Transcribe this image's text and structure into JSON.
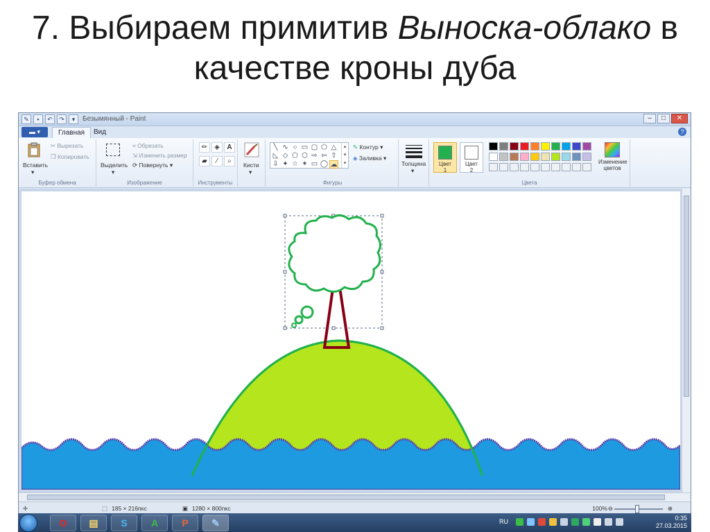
{
  "slide": {
    "title_part1": "7. Выбираем примитив ",
    "title_italic1": "Выноска-облако",
    "title_part2": " в качестве кроны дуба"
  },
  "window": {
    "title": "Безымянный - Paint",
    "qat_icons": [
      "paint-icon",
      "save-icon",
      "undo-icon",
      "redo-icon",
      "dropdown-icon"
    ],
    "controls": [
      "minimize-icon",
      "maximize-icon",
      "close-icon"
    ]
  },
  "tabs": {
    "file_menu": "▾",
    "home": "Главная",
    "view": "Вид"
  },
  "ribbon": {
    "clipboard": {
      "paste": "Вставить",
      "cut": "Вырезать",
      "copy": "Копировать",
      "label": "Буфер обмена"
    },
    "image": {
      "select": "Выделить",
      "crop": "Обрезать",
      "resize": "Изменить размер",
      "rotate": "Повернуть",
      "label": "Изображение"
    },
    "tools": {
      "label": "Инструменты",
      "items": [
        "pencil-icon",
        "fill-icon",
        "text-icon",
        "eraser-icon",
        "color-picker-icon",
        "magnifier-icon"
      ]
    },
    "brushes": {
      "label": "Кисти"
    },
    "shapes": {
      "label": "Фигуры",
      "outline": "Контур",
      "fill": "Заливка",
      "glyphs": [
        "╲",
        "∿",
        "○",
        "▭",
        "▢",
        "⬠",
        "△",
        "◺",
        "◇",
        "⬡",
        "⬡",
        "▷",
        "⇧",
        "⇩",
        "⇦",
        "✦",
        "☆",
        "✶",
        "▭",
        "▢",
        "◯"
      ]
    },
    "thickness": {
      "label": "Толщина"
    },
    "colors": {
      "label": "Цвета",
      "color1": "Цвет",
      "color1_num": "1",
      "color2": "Цвет",
      "color2_num": "2",
      "color1_value": "#22b14c",
      "color2_value": "#ffffff",
      "edit": "Изменение цветов",
      "palette_row1": [
        "#000000",
        "#7f7f7f",
        "#880015",
        "#ed1c24",
        "#ff7f27",
        "#fff200",
        "#22b14c",
        "#00a2e8",
        "#3f48cc",
        "#a349a4"
      ],
      "palette_row2": [
        "#ffffff",
        "#c3c3c3",
        "#b97a57",
        "#ffaec9",
        "#ffc90e",
        "#efe4b0",
        "#b5e61d",
        "#99d9ea",
        "#7092be",
        "#c8bfe7"
      ]
    }
  },
  "canvas": {
    "hill_color": "#b5e61d",
    "hill_outline": "#22b14c",
    "water_color": "#1e9be0",
    "wave_color": "#5b3fa8",
    "trunk_color": "#880015",
    "cloud_color": "#22b14c"
  },
  "statusbar": {
    "selection_size": "185 × 216пкс",
    "image_size": "1280 × 800пкс",
    "zoom": "100%"
  },
  "taskbar": {
    "apps": [
      "opera-icon",
      "explorer-icon",
      "skype-icon",
      "app-a-icon",
      "powerpoint-icon",
      "paint-icon"
    ],
    "app_glyphs": [
      "O",
      "▤",
      "S",
      "A",
      "P",
      "✎"
    ],
    "language": "RU",
    "time": "0:35",
    "date": "27.03.2015"
  }
}
